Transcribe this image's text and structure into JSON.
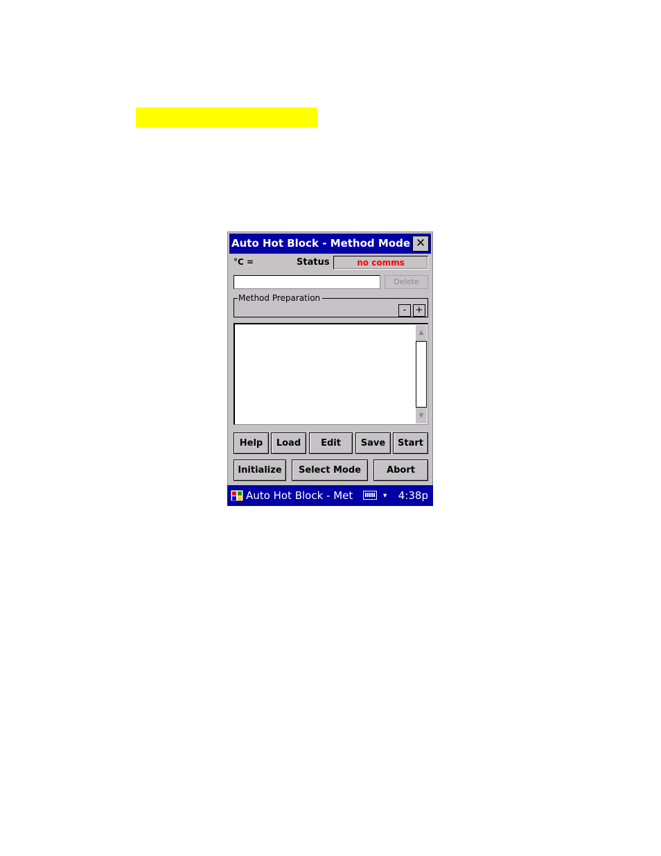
{
  "highlight_color": "#ffff00",
  "window": {
    "title": "Auto Hot Block - Method Mode",
    "close_label": "✕",
    "temperature_label": "°C =",
    "status_label": "Status",
    "status_value": "no comms",
    "method_name_value": "",
    "delete_label": "Delete",
    "group_title": "Method Preparation",
    "minus_label": "-",
    "plus_label": "+",
    "scroll_up": "▲",
    "scroll_down": "▼",
    "buttons_row1": [
      "Help",
      "Load",
      "Edit",
      "Save",
      "Start"
    ],
    "buttons_row2": [
      "Initialize",
      "Select Mode",
      "Abort"
    ]
  },
  "taskbar": {
    "title": "Auto Hot Block - Met",
    "keyboard_arrow": "▼",
    "clock": "4:38p"
  },
  "colors": {
    "titlebar": "#0000a5",
    "window_bg": "#c6c3c6",
    "status_text": "#ff0000"
  }
}
